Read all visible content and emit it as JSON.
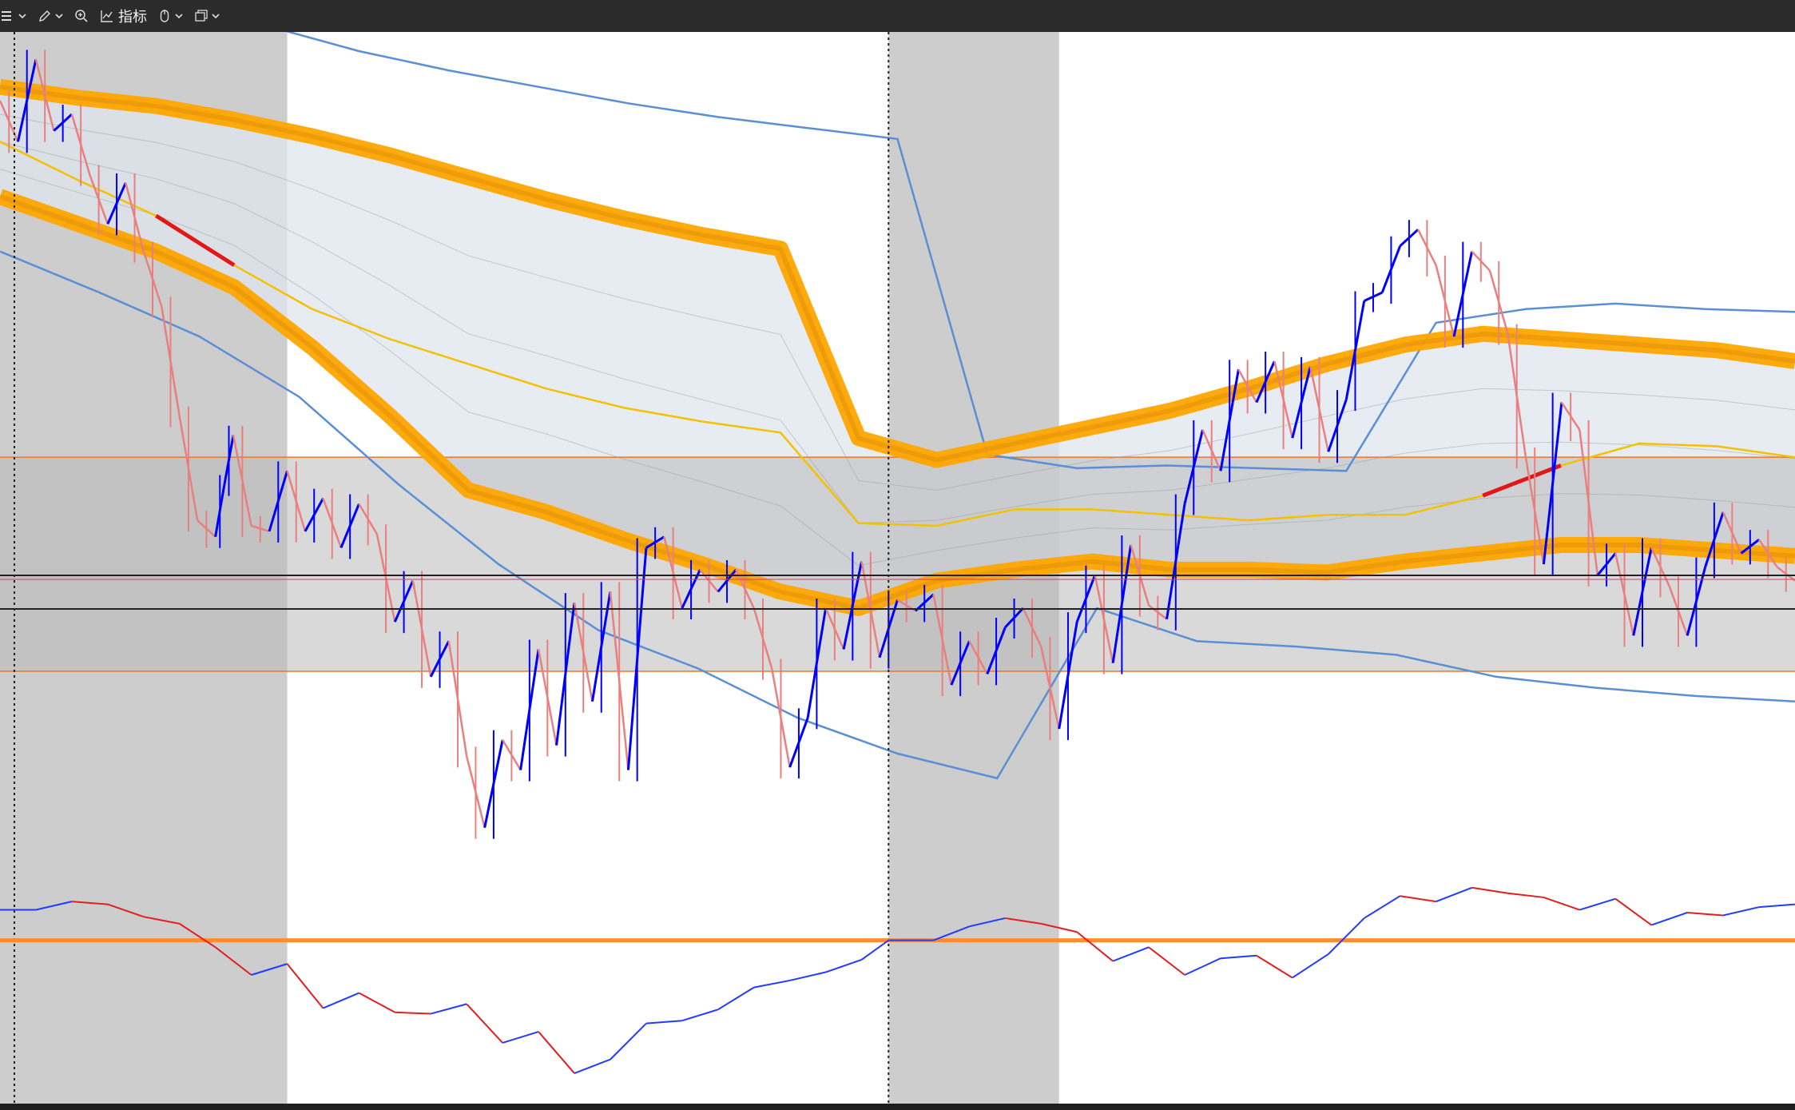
{
  "toolbar": {
    "items": [
      {
        "icon": "bars-icon",
        "has_caret": true
      },
      {
        "icon": "pencil-icon",
        "has_caret": true
      },
      {
        "icon": "zoom-in-icon",
        "has_caret": false
      },
      {
        "icon": "indicator-chart-icon",
        "label": "指标",
        "has_caret": false
      },
      {
        "icon": "mouse-icon",
        "has_caret": true
      },
      {
        "icon": "windows-icon",
        "has_caret": true
      }
    ]
  },
  "colors": {
    "toolbar_bg": "#2b2b2b",
    "up_bar": "#0000ff",
    "down_bar": "#e98080",
    "orange_band": "#ffa500",
    "orange_band_dark": "#e0900a",
    "yellow_line": "#f2c200",
    "blue_envelope": "#5b8fd4",
    "channel_fill": "#dfe5ef",
    "session_shade": "#c8c8c8",
    "range_box_fill": "#b9b9b9",
    "range_box_line": "#e57a2a",
    "osc_line_up": "#1f3cff",
    "osc_line_down": "#e02020",
    "osc_zero_line": "#ff8c33",
    "red_segment": "#e01818"
  },
  "chart_data": {
    "type": "line",
    "panels": [
      "price",
      "oscillator"
    ],
    "price": {
      "series": [
        {
          "style": "candles",
          "x": [
            0,
            10,
            20,
            30,
            40,
            50,
            60,
            70,
            80,
            90,
            100,
            110,
            120,
            125,
            130,
            140,
            150,
            160,
            170,
            180,
            190,
            200,
            210,
            220,
            230,
            240,
            250,
            260,
            270,
            280,
            290,
            300,
            310,
            320,
            330,
            340,
            350,
            360,
            370,
            380,
            390,
            400,
            410,
            420,
            430,
            440,
            450,
            460,
            470,
            480,
            490,
            500,
            510,
            520,
            530,
            540,
            550,
            560,
            570,
            580,
            590,
            600,
            610,
            620,
            630,
            640,
            650,
            660,
            670,
            680,
            690,
            700,
            710,
            720,
            730,
            740,
            750,
            760,
            770,
            780,
            790,
            800,
            810,
            820,
            830,
            840,
            850,
            860,
            870,
            880,
            890,
            900,
            910,
            920,
            930,
            940,
            950,
            960,
            970,
            980,
            990,
            1000
          ],
          "y": [
            97.5,
            96.0,
            99.0,
            96.4,
            97.0,
            94.8,
            93.0,
            94.5,
            92.0,
            90.0,
            86.0,
            82.2,
            81.6,
            83.5,
            85.3,
            82.0,
            81.8,
            84.0,
            81.8,
            83.0,
            81.2,
            82.8,
            81.7,
            78.5,
            80.0,
            76.5,
            77.8,
            73.6,
            71.0,
            74.2,
            73.1,
            77.5,
            74.0,
            79.2,
            75.6,
            79.6,
            73.1,
            81.2,
            81.6,
            79.0,
            80.4,
            79.6,
            80.4,
            79.0,
            76.8,
            73.2,
            75.0,
            79.0,
            77.5,
            80.7,
            77.2,
            79.3,
            78.9,
            79.5,
            76.2,
            77.8,
            76.6,
            78.3,
            79.0,
            77.6,
            74.6,
            78.5,
            80.2,
            77.0,
            81.3,
            79.1,
            78.6,
            82.8,
            85.5,
            84.0,
            87.7,
            86.5,
            88.0,
            85.2,
            87.8,
            84.7,
            86.6,
            90.2,
            90.5,
            92.2,
            92.8,
            91.5,
            88.9,
            92.0,
            91.3,
            89.0,
            84.5,
            80.6,
            86.5,
            85.5,
            80.2,
            81.0,
            78.0,
            81.2,
            79.8,
            78.0,
            80.5,
            82.5,
            81.0,
            81.5,
            80.5,
            80.0
          ]
        },
        {
          "style": "band",
          "name": "orange-upper",
          "y": [
            98,
            97.6,
            97.3,
            96.8,
            96.2,
            95.5,
            94.7,
            93.9,
            93.2,
            92.6,
            92.1,
            85.2,
            84.4,
            85.0,
            85.6,
            86.2,
            87.0,
            87.9,
            88.6,
            89.0,
            88.8,
            88.6,
            88.4,
            88.0
          ]
        },
        {
          "style": "band",
          "name": "orange-lower",
          "y": [
            94,
            93.0,
            92.0,
            90.7,
            88.5,
            86.0,
            83.3,
            82.5,
            81.5,
            80.6,
            79.6,
            79.0,
            80.0,
            80.4,
            80.7,
            80.4,
            80.4,
            80.3,
            80.7,
            81.0,
            81.3,
            81.3,
            81.1,
            80.9
          ]
        },
        {
          "style": "line",
          "name": "yellow-mean",
          "y": [
            96.0,
            94.6,
            93.3,
            91.5,
            89.9,
            88.8,
            87.9,
            87.0,
            86.3,
            85.8,
            85.4,
            82.1,
            82.0,
            82.6,
            82.6,
            82.4,
            82.2,
            82.4,
            82.4,
            83.1,
            84.2,
            85.0,
            84.9,
            84.5
          ]
        },
        {
          "style": "line",
          "name": "blue-upper",
          "y": [
            102,
            101.5,
            101,
            100.2,
            99.3,
            98.6,
            98.0,
            97.4,
            96.9,
            96.5,
            96.1,
            84.6,
            84.1,
            84.2,
            84.1,
            84.0,
            89.4,
            89.9,
            90.1,
            89.9,
            89.8
          ]
        },
        {
          "style": "line",
          "name": "blue-lower",
          "y": [
            92,
            90.5,
            88.9,
            86.7,
            83.5,
            80.6,
            78.2,
            76.8,
            75.0,
            73.7,
            72.8,
            79.0,
            77.8,
            77.6,
            77.3,
            76.5,
            76.1,
            75.8,
            75.6
          ]
        }
      ],
      "range_box": {
        "y_top": 84.5,
        "y_bottom": 76.7
      },
      "shaded_sessions": [
        [
          0,
          160
        ],
        [
          495,
          590
        ]
      ],
      "vline_sessions": [
        8,
        495
      ],
      "ylim": [
        70,
        100
      ]
    },
    "oscillator": {
      "x": [
        0,
        20,
        40,
        60,
        80,
        100,
        120,
        140,
        160,
        180,
        200,
        220,
        240,
        260,
        280,
        300,
        320,
        340,
        360,
        380,
        400,
        420,
        440,
        460,
        480,
        495,
        520,
        540,
        560,
        580,
        600,
        620,
        640,
        660,
        680,
        700,
        720,
        740,
        760,
        780,
        800,
        820,
        840,
        860,
        880,
        900,
        920,
        940,
        960,
        980,
        1000
      ],
      "y": [
        2.2,
        2.2,
        2.8,
        2.6,
        1.7,
        1.2,
        -0.5,
        -2.5,
        -1.7,
        -4.9,
        -3.8,
        -5.2,
        -5.3,
        -4.6,
        -7.4,
        -6.6,
        -9.6,
        -8.6,
        -6.0,
        -5.8,
        -5.0,
        -3.4,
        -2.9,
        -2.3,
        -1.4,
        0,
        0,
        1.0,
        1.6,
        1.2,
        0.6,
        -1.5,
        -0.5,
        -2.5,
        -1.3,
        -1.1,
        -2.7,
        -1.0,
        1.6,
        3.2,
        2.8,
        3.8,
        3.4,
        3.1,
        2.2,
        3.0,
        1.1,
        2.0,
        1.8,
        2.4,
        2.6
      ],
      "zero": 0,
      "ylim": [
        -10,
        5
      ]
    }
  }
}
